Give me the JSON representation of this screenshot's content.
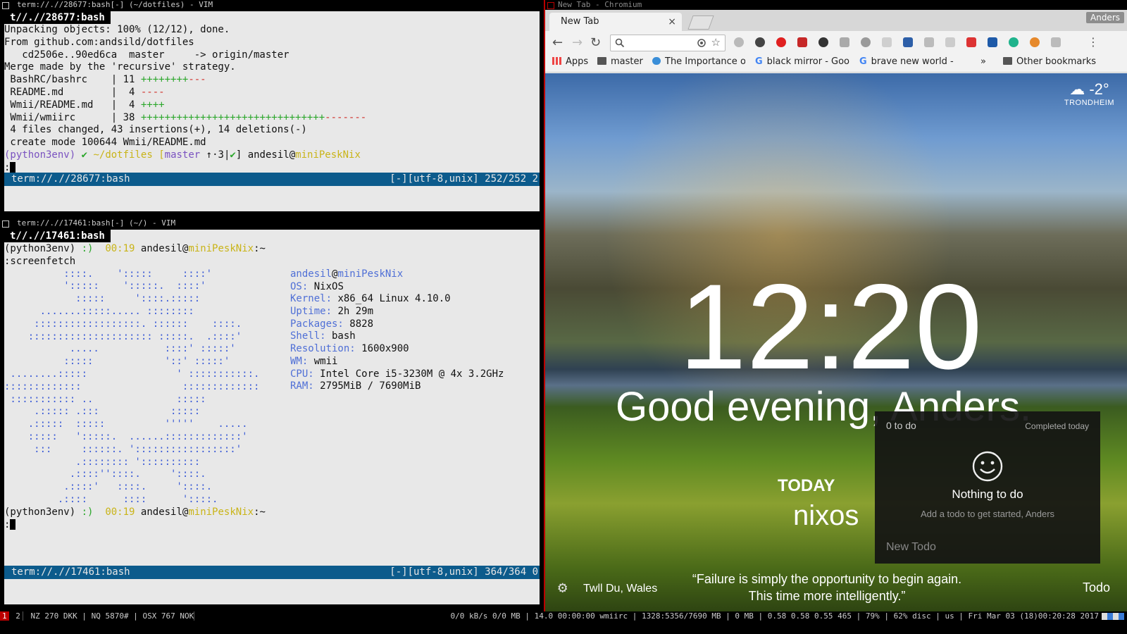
{
  "top_terminal": {
    "window_title": "term://.//28677:bash[-] (~/dotfiles) - VIM",
    "tab_label": "t//.//28677:bash",
    "lines": [
      "Unpacking objects: 100% (12/12), done.",
      "From github.com:andsild/dotfiles",
      "   cd2506e..90ed6ca  master     -> origin/master",
      "Merge made by the 'recursive' strategy."
    ],
    "diffstat": [
      {
        "file": " BashRC/bashrc    | 11 ",
        "plus": "++++++++",
        "minus": "---"
      },
      {
        "file": " README.md        |  4 ",
        "plus": "",
        "minus": "----"
      },
      {
        "file": " Wmii/README.md   |  4 ",
        "plus": "++++",
        "minus": ""
      },
      {
        "file": " Wmii/wmiirc      | 38 ",
        "plus": "+++++++++++++++++++++++++++++++",
        "minus": "-------"
      }
    ],
    "summary": " 4 files changed, 43 insertions(+), 14 deletions(-)",
    "create_line": " create mode 100644 Wmii/README.md",
    "prompt": {
      "env": "(python3env)",
      "check": "✔",
      "dir": "~/dotfiles",
      "branch_open": "[",
      "branch": "master",
      "ahead": "↑·3",
      "bar": "|",
      "ok": "✔",
      "branch_close": "]",
      "user": "andesil",
      "at": "@",
      "host": "miniPeskNix"
    },
    "cmdline": ":",
    "status_left": "term://.//28677:bash",
    "status_right": "[-][utf-8,unix] 252/252 2"
  },
  "bottom_terminal": {
    "window_title": "term://.//17461:bash[-] (~/) - VIM",
    "tab_label": "t//.//17461:bash",
    "prompt1": {
      "env": "(python3env)",
      "smile": ":)",
      "time": "00:19",
      "user": "andesil@",
      "host": "miniPeskNix",
      "path": ":~"
    },
    "cmd": ":screenfetch",
    "ascii_logo": [
      "          ::::.    ':::::     ::::'",
      "          ':::::    ':::::.  ::::'",
      "            :::::     '::::.:::::",
      "      .......:::::..... ::::::::",
      "     ::::::::::::::::::. ::::::    ::::.",
      "    ::::::::::::::::::::: :::::.  .::::'",
      "           .....           ::::' :::::'",
      "          :::::            '::' :::::'",
      " ........:::::               ' :::::::::::.",
      ":::::::::::::                 :::::::::::::",
      " ::::::::::: ..              :::::",
      "     .::::: .:::            :::::",
      "    .:::::  :::::          '''''    .....",
      "    :::::   ':::::.  ......:::::::::::::'",
      "     :::     ::::::. ':::::::::::::::::'",
      "            .:::::::: '::::::::::",
      "           .::::''::::.     '::::.",
      "          .::::'   ::::.     '::::.",
      "         .::::      ::::      '::::."
    ],
    "sysinfo_header": {
      "user": "andesil",
      "at": "@",
      "host": "miniPeskNix"
    },
    "sysinfo": [
      {
        "label": "OS:",
        "value": " NixOS"
      },
      {
        "label": "Kernel:",
        "value": " x86_64 Linux 4.10.0"
      },
      {
        "label": "Uptime:",
        "value": " 2h 29m"
      },
      {
        "label": "Packages:",
        "value": " 8828"
      },
      {
        "label": "Shell:",
        "value": " bash"
      },
      {
        "label": "Resolution:",
        "value": " 1600x900"
      },
      {
        "label": "WM:",
        "value": " wmii"
      },
      {
        "label": "CPU:",
        "value": " Intel Core i5-3230M @ 4x 3.2GHz"
      },
      {
        "label": "RAM:",
        "value": " 2795MiB / 7690MiB"
      }
    ],
    "prompt2": {
      "env": "(python3env)",
      "smile": ":)",
      "time": "00:19",
      "user": "andesil@",
      "host": "miniPeskNix",
      "path": ":~"
    },
    "cmdline": ":",
    "status_left": "term://.//17461:bash",
    "status_right": "[-][utf-8,unix] 364/364 0"
  },
  "browser": {
    "window_title": "New Tab - Chromium",
    "tab_title": "New Tab",
    "tab_close": "×",
    "profile_name": "Anders",
    "back": "←",
    "forward": "→",
    "reload": "↻",
    "menu": "⋮",
    "star": "☆",
    "bookmarks": {
      "apps": "Apps",
      "items": [
        "master",
        "The Importance o",
        "black mirror - Goo",
        "brave new world -"
      ],
      "overflow": "»",
      "other": "Other bookmarks"
    },
    "weather": {
      "temp": "-2°",
      "city": "TRONDHEIM",
      "icon": "snow-cloud-icon"
    },
    "clock": "12:20",
    "greeting": "Good evening, Anders.",
    "focus_heading": "TODAY",
    "focus_text": "nixos",
    "todo_panel": {
      "count": "0 to do",
      "completed": "Completed today",
      "empty_title": "Nothing to do",
      "empty_sub": "Add a todo to get started, Anders",
      "new_placeholder": "New Todo"
    },
    "location": "Twll Du, Wales",
    "quote_line1": "“Failure is simply the opportunity to begin again.",
    "quote_line2": "This time more intelligently.”",
    "todo_link": "Todo",
    "colors": {
      "accent_border": "#bb0000",
      "status_blue": "#0c5b8c"
    }
  },
  "wm_bar": {
    "tags": [
      "1",
      "2"
    ],
    "left_info": "NZ 270 DKK  | NQ 5870#  | OSX 767 NOK ",
    "right_info": "0/0 kB/s 0/0 MB | 14.0 00:00:00 wmiirc | 1328:5356/7690 MB | 0 MB | 0.58 0.58 0.55 465 | 79% | 62% disc | us | Fri Mar 03 (18)00:20:28 2017"
  }
}
